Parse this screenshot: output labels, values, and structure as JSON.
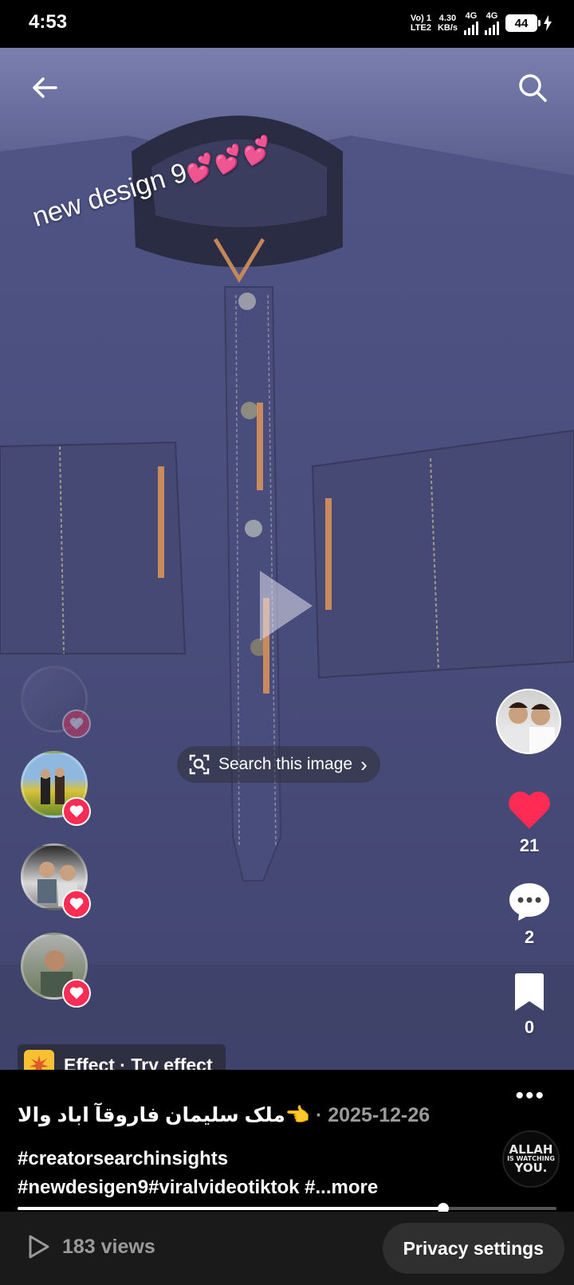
{
  "status_bar": {
    "time": "4:53",
    "volte_top": "Vo) 1",
    "volte_bottom": "LTE2",
    "speed_value": "4.30",
    "speed_unit": "KB/s",
    "sim1_label": "4G",
    "sim2_label": "4G",
    "battery": "44"
  },
  "video": {
    "overlay_text": "new design 9",
    "overlay_emoji": "💕💕💕",
    "search_image_label": "Search this image",
    "search_chevron": "›"
  },
  "actions": {
    "likes": "21",
    "comments": "2",
    "saves": "0"
  },
  "effect": {
    "label": "Effect · Try effect"
  },
  "caption": {
    "author_text": "ملک سلیمان فاروقآ اباد والا",
    "pointing_emoji": "👈",
    "separator": " · ",
    "date": "2025-12-26"
  },
  "hashtags": {
    "line1": "#creatorsearchinsights",
    "line2": "#newdesigen9#viralvideotiktok #",
    "more": "...more"
  },
  "profile_badge": {
    "line1": "ALLAH",
    "line2": "IS WATCHING",
    "line3": "YOU."
  },
  "playback": {
    "progress_fraction": 0.79
  },
  "footer": {
    "views": "183 views",
    "privacy_button": "Privacy settings"
  },
  "icons": [
    "back-arrow-icon",
    "search-icon",
    "play-icon",
    "image-search-icon",
    "heart-icon",
    "comment-icon",
    "bookmark-icon",
    "more-icon",
    "effect-icon",
    "views-play-icon"
  ],
  "colors": {
    "like_red": "#fe2c55",
    "effect_yellow": "#f6c133",
    "muted_text": "#9a9a9a"
  }
}
